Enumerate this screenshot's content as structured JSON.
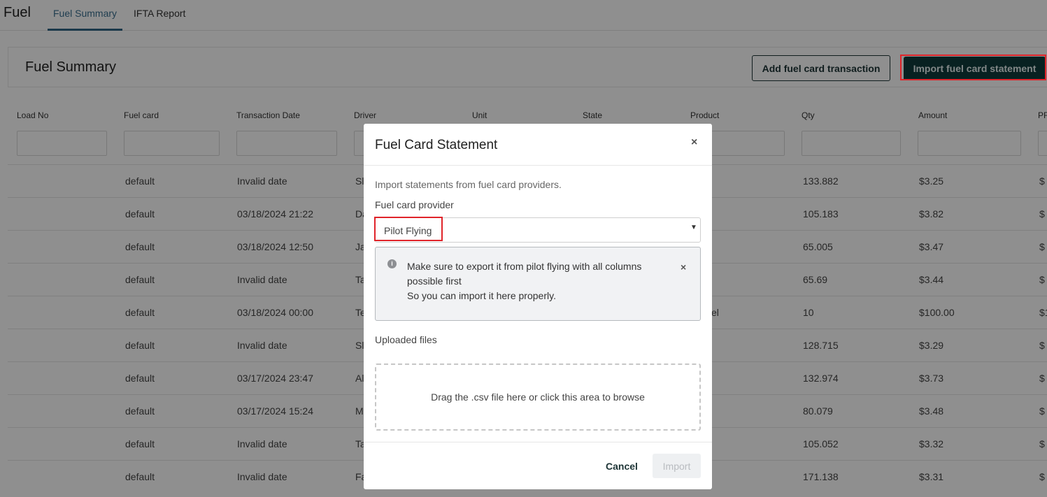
{
  "app": {
    "title": "Fuel"
  },
  "tabs": [
    {
      "label": "Fuel Summary",
      "active": true
    },
    {
      "label": "IFTA Report",
      "active": false
    }
  ],
  "panel": {
    "title": "Fuel Summary",
    "add_button": "Add fuel card transaction",
    "import_button": "Import fuel card statement"
  },
  "table": {
    "columns": [
      "Load No",
      "Fuel card",
      "Transaction Date",
      "Driver",
      "Unit",
      "State",
      "Product",
      "Qty",
      "Amount",
      "PF"
    ],
    "rows": [
      {
        "fuel_card": "default",
        "date": "Invalid date",
        "driver": "Sl",
        "product": "",
        "qty": "133.882",
        "amount": "$3.25",
        "extra": "$"
      },
      {
        "fuel_card": "default",
        "date": "03/18/2024 21:22",
        "driver": "Da",
        "product": "",
        "qty": "105.183",
        "amount": "$3.82",
        "extra": "$"
      },
      {
        "fuel_card": "default",
        "date": "03/18/2024 12:50",
        "driver": "Ja",
        "product": "",
        "qty": "65.005",
        "amount": "$3.47",
        "extra": "$"
      },
      {
        "fuel_card": "default",
        "date": "Invalid date",
        "driver": "Ta",
        "product": "",
        "qty": "65.69",
        "amount": "$3.44",
        "extra": "$"
      },
      {
        "fuel_card": "default",
        "date": "03/18/2024 00:00",
        "driver": "Te",
        "product": "el",
        "qty": "10",
        "amount": "$100.00",
        "extra": "$1"
      },
      {
        "fuel_card": "default",
        "date": "Invalid date",
        "driver": "Sl",
        "product": "",
        "qty": "128.715",
        "amount": "$3.29",
        "extra": "$"
      },
      {
        "fuel_card": "default",
        "date": "03/17/2024 23:47",
        "driver": "Al",
        "product": "",
        "qty": "132.974",
        "amount": "$3.73",
        "extra": "$"
      },
      {
        "fuel_card": "default",
        "date": "03/17/2024 15:24",
        "driver": "M",
        "product": "",
        "qty": "80.079",
        "amount": "$3.48",
        "extra": "$"
      },
      {
        "fuel_card": "default",
        "date": "Invalid date",
        "driver": "Ta",
        "product": "",
        "qty": "105.052",
        "amount": "$3.32",
        "extra": "$"
      },
      {
        "fuel_card": "default",
        "date": "Invalid date",
        "driver": "Fa",
        "product": "",
        "qty": "171.138",
        "amount": "$3.31",
        "extra": "$"
      }
    ]
  },
  "modal": {
    "title": "Fuel Card Statement",
    "close_icon": "×",
    "description": "Import statements from fuel card providers.",
    "provider_label": "Fuel card provider",
    "provider_value": "Pilot Flying",
    "caret_icon": "▼",
    "alert_icon": "i",
    "alert_line1": "Make sure to export it from pilot flying with all columns possible first",
    "alert_line2": "So you can import it here properly.",
    "alert_close_icon": "×",
    "uploaded_label": "Uploaded files",
    "dropzone_text": "Drag the .csv file here or click this area to browse",
    "cancel_button": "Cancel",
    "import_button": "Import"
  },
  "colors": {
    "accent": "#0f3b3c",
    "highlight": "#e0242a",
    "tab_active": "#2f6485"
  }
}
